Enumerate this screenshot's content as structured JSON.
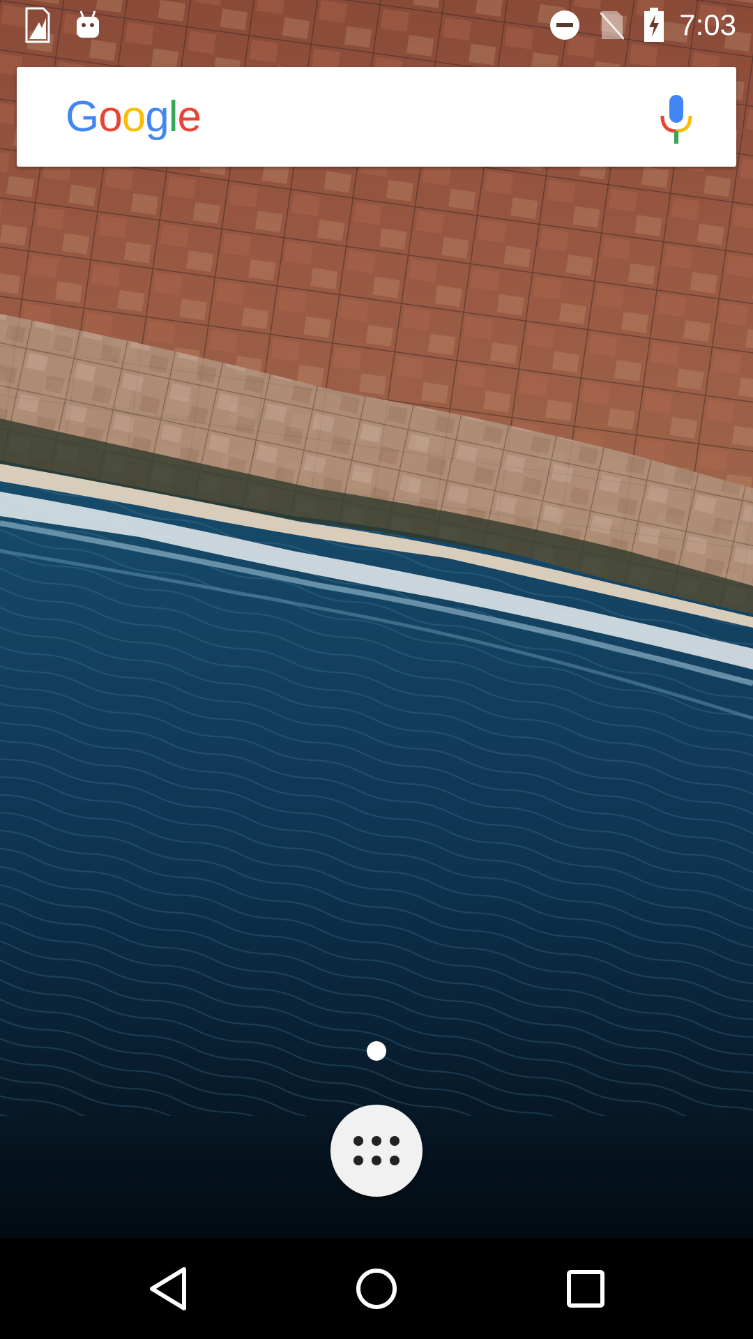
{
  "status_bar": {
    "time": "7:03",
    "left_icons": [
      "sd-card-icon",
      "android-debug-icon"
    ],
    "right_icons": [
      "do-not-disturb-icon",
      "no-sim-icon",
      "battery-charging-icon"
    ]
  },
  "search_widget": {
    "logo_letters": [
      {
        "char": "G",
        "color": "#4285F4"
      },
      {
        "char": "o",
        "color": "#EA4335"
      },
      {
        "char": "o",
        "color": "#FBBC05"
      },
      {
        "char": "g",
        "color": "#4285F4"
      },
      {
        "char": "l",
        "color": "#34A853"
      },
      {
        "char": "e",
        "color": "#EA4335"
      }
    ],
    "voice_icon": "mic-icon"
  },
  "home": {
    "pages": 1,
    "current_page": 1,
    "app_drawer_icon": "app-drawer-icon"
  },
  "nav_bar": {
    "buttons": [
      "back-icon",
      "home-icon",
      "recents-icon"
    ]
  },
  "colors": {
    "status_icon": "#ffffff",
    "search_bg": "#ffffff",
    "drawer_button_bg": "#f1f1f1",
    "drawer_dots": "#222222",
    "nav_icon": "#ffffff"
  }
}
